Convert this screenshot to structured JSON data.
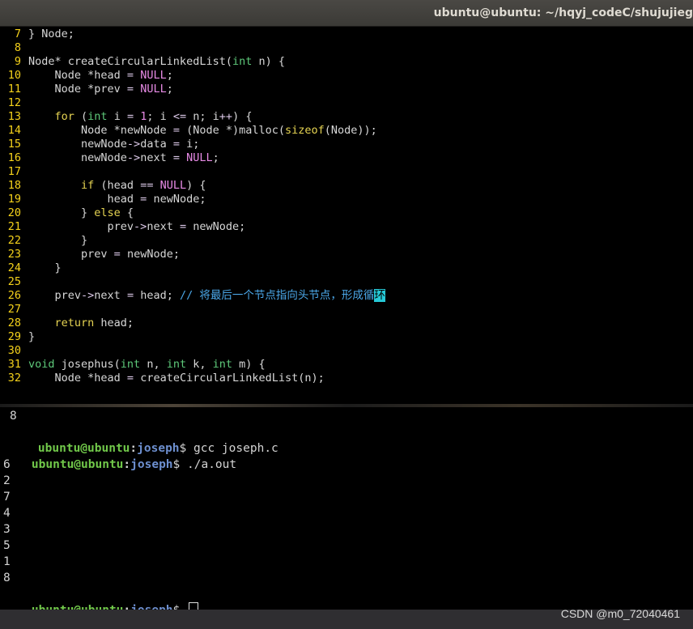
{
  "window": {
    "title": "ubuntu@ubuntu: ~/hqyj_codeC/shujujieg"
  },
  "editor": {
    "lines": [
      {
        "n": "7",
        "segs": [
          [
            "plain",
            "} Node;"
          ]
        ]
      },
      {
        "n": "8",
        "segs": []
      },
      {
        "n": "9",
        "segs": [
          [
            "plain",
            "Node* createCircularLinkedList("
          ],
          [
            "ty",
            "int"
          ],
          [
            "plain",
            " n) {"
          ]
        ]
      },
      {
        "n": "10",
        "segs": [
          [
            "plain",
            "    Node *head "
          ],
          [
            "op",
            "="
          ],
          [
            "plain",
            " "
          ],
          [
            "cst",
            "NULL"
          ],
          [
            "plain",
            ";"
          ]
        ]
      },
      {
        "n": "11",
        "segs": [
          [
            "plain",
            "    Node *prev "
          ],
          [
            "op",
            "="
          ],
          [
            "plain",
            " "
          ],
          [
            "cst",
            "NULL"
          ],
          [
            "plain",
            ";"
          ]
        ]
      },
      {
        "n": "12",
        "segs": []
      },
      {
        "n": "13",
        "segs": [
          [
            "plain",
            "    "
          ],
          [
            "kw",
            "for"
          ],
          [
            "plain",
            " ("
          ],
          [
            "ty",
            "int"
          ],
          [
            "plain",
            " i "
          ],
          [
            "op",
            "="
          ],
          [
            "plain",
            " "
          ],
          [
            "cst",
            "1"
          ],
          [
            "plain",
            "; i "
          ],
          [
            "op",
            "<="
          ],
          [
            "plain",
            " n; i"
          ],
          [
            "op",
            "++"
          ],
          [
            "plain",
            ") {"
          ]
        ]
      },
      {
        "n": "14",
        "segs": [
          [
            "plain",
            "        Node *newNode "
          ],
          [
            "op",
            "="
          ],
          [
            "plain",
            " (Node *)malloc("
          ],
          [
            "kw",
            "sizeof"
          ],
          [
            "plain",
            "(Node));"
          ]
        ]
      },
      {
        "n": "15",
        "segs": [
          [
            "plain",
            "        newNode"
          ],
          [
            "op",
            "->"
          ],
          [
            "plain",
            "data "
          ],
          [
            "op",
            "="
          ],
          [
            "plain",
            " i;"
          ]
        ]
      },
      {
        "n": "16",
        "segs": [
          [
            "plain",
            "        newNode"
          ],
          [
            "op",
            "->"
          ],
          [
            "plain",
            "next "
          ],
          [
            "op",
            "="
          ],
          [
            "plain",
            " "
          ],
          [
            "cst",
            "NULL"
          ],
          [
            "plain",
            ";"
          ]
        ]
      },
      {
        "n": "17",
        "segs": []
      },
      {
        "n": "18",
        "segs": [
          [
            "plain",
            "        "
          ],
          [
            "kw",
            "if"
          ],
          [
            "plain",
            " (head "
          ],
          [
            "op",
            "=="
          ],
          [
            "plain",
            " "
          ],
          [
            "cst",
            "NULL"
          ],
          [
            "plain",
            ") {"
          ]
        ]
      },
      {
        "n": "19",
        "segs": [
          [
            "plain",
            "            head "
          ],
          [
            "op",
            "="
          ],
          [
            "plain",
            " newNode;"
          ]
        ]
      },
      {
        "n": "20",
        "segs": [
          [
            "plain",
            "        } "
          ],
          [
            "kw",
            "else"
          ],
          [
            "plain",
            " {"
          ]
        ]
      },
      {
        "n": "21",
        "segs": [
          [
            "plain",
            "            prev"
          ],
          [
            "op",
            "->"
          ],
          [
            "plain",
            "next "
          ],
          [
            "op",
            "="
          ],
          [
            "plain",
            " newNode;"
          ]
        ]
      },
      {
        "n": "22",
        "segs": [
          [
            "plain",
            "        }"
          ]
        ]
      },
      {
        "n": "23",
        "segs": [
          [
            "plain",
            "        prev "
          ],
          [
            "op",
            "="
          ],
          [
            "plain",
            " newNode;"
          ]
        ]
      },
      {
        "n": "24",
        "segs": [
          [
            "plain",
            "    }"
          ]
        ]
      },
      {
        "n": "25",
        "segs": []
      },
      {
        "n": "26",
        "segs": [
          [
            "plain",
            "    prev"
          ],
          [
            "op",
            "->"
          ],
          [
            "plain",
            "next "
          ],
          [
            "op",
            "="
          ],
          [
            "plain",
            " head; "
          ],
          [
            "cm",
            "// 将最后一个节点指向头节点，形成循"
          ],
          [
            "cursor",
            "环"
          ]
        ]
      },
      {
        "n": "27",
        "segs": []
      },
      {
        "n": "28",
        "segs": [
          [
            "plain",
            "    "
          ],
          [
            "kw",
            "return"
          ],
          [
            "plain",
            " head;"
          ]
        ]
      },
      {
        "n": "29",
        "segs": [
          [
            "plain",
            "}"
          ]
        ]
      },
      {
        "n": "30",
        "segs": []
      },
      {
        "n": "31",
        "segs": [
          [
            "ty",
            "void"
          ],
          [
            "plain",
            " josephus("
          ],
          [
            "ty",
            "int"
          ],
          [
            "plain",
            " n, "
          ],
          [
            "ty",
            "int"
          ],
          [
            "plain",
            " k, "
          ],
          [
            "ty",
            "int"
          ],
          [
            "plain",
            " m) {"
          ]
        ]
      },
      {
        "n": "32",
        "segs": [
          [
            "plain",
            "    Node *head "
          ],
          [
            "op",
            "="
          ],
          [
            "plain",
            " createCircularLinkedList(n);"
          ]
        ]
      }
    ]
  },
  "terminal": {
    "prev_output": "8",
    "prompt": {
      "user": "ubuntu@ubuntu",
      "colon": ":",
      "path": "joseph",
      "symbol": "$ "
    },
    "cmd1": "gcc joseph.c",
    "cmd2": "./a.out",
    "output": [
      "6",
      "2",
      "7",
      "4",
      "3",
      "5",
      "1",
      "8"
    ]
  },
  "watermark": "CSDN @m0_72040461",
  "colors": {
    "line_number": "#f5d21b",
    "type": "#5ec97a",
    "keyword": "#e6d452",
    "constant": "#e88be6",
    "comment": "#4ba7e8",
    "prompt_user": "#71c84a",
    "prompt_path": "#6d8fcf"
  }
}
